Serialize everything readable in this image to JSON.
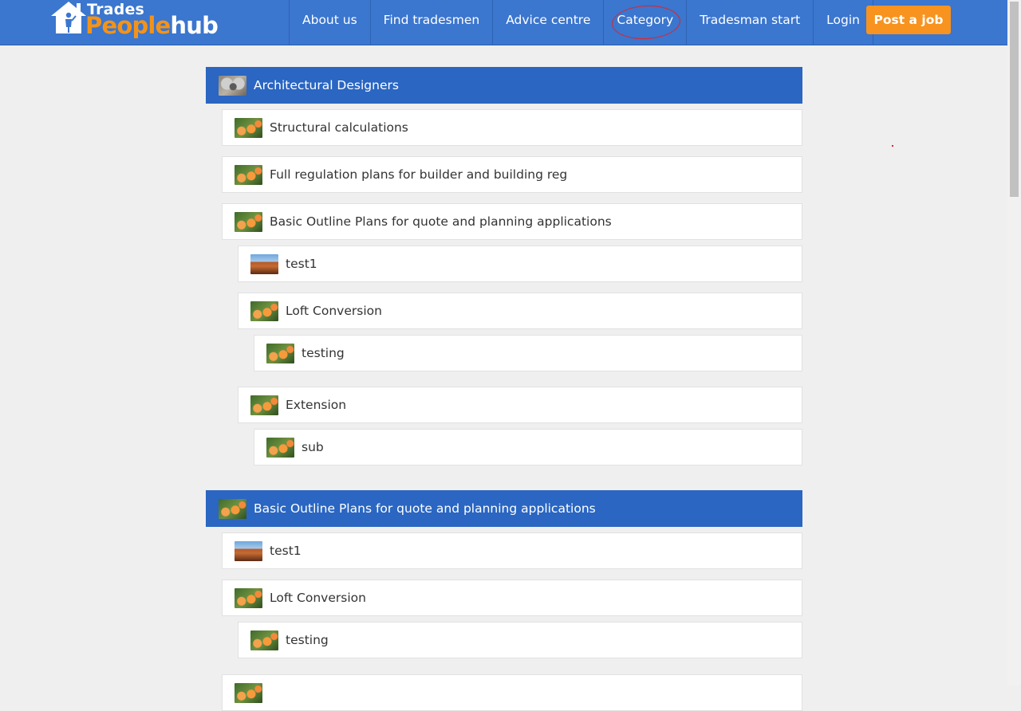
{
  "header": {
    "logo": {
      "line1": "Trades",
      "line2a": "People",
      "line2b": "hub"
    },
    "nav": [
      "About us",
      "Find tradesmen",
      "Advice centre",
      "Category",
      "Tradesman start",
      "Login"
    ],
    "cta": "Post a job",
    "highlighted_nav": "Category"
  },
  "colors": {
    "header_bg": "#3b76cf",
    "section_header_bg": "#2a66c2",
    "cta_bg": "#f7931e",
    "annotation": "#e0242a"
  },
  "categories": [
    {
      "label": "Architectural Designers",
      "level": 0,
      "header": true,
      "image": "koala-thumbnail"
    },
    {
      "label": "Structural calculations",
      "level": 1,
      "image": "rose-thumbnail"
    },
    {
      "label": "Full regulation plans for builder and building reg",
      "level": 1,
      "image": "rose-thumbnail"
    },
    {
      "label": "Basic Outline Plans for quote and planning applications",
      "level": 1,
      "image": "rose-thumbnail"
    },
    {
      "label": "test1",
      "level": 2,
      "image": "mesa-thumbnail"
    },
    {
      "label": "Loft Conversion",
      "level": 2,
      "image": "rose-thumbnail"
    },
    {
      "label": "testing",
      "level": 3,
      "image": "rose-thumbnail"
    },
    {
      "label": "Extension",
      "level": 2,
      "image": "rose-thumbnail"
    },
    {
      "label": "sub",
      "level": 3,
      "image": "rose-thumbnail"
    },
    {
      "label": "Basic Outline Plans for quote and planning applications",
      "level": 0,
      "header": true,
      "image": "rose-thumbnail"
    },
    {
      "label": "test1",
      "level": 1,
      "image": "mesa-thumbnail"
    },
    {
      "label": "Loft Conversion",
      "level": 1,
      "image": "rose-thumbnail"
    },
    {
      "label": "testing",
      "level": 2,
      "image": "rose-thumbnail"
    },
    {
      "label": "",
      "level": 1,
      "image": "rose-thumbnail"
    }
  ]
}
